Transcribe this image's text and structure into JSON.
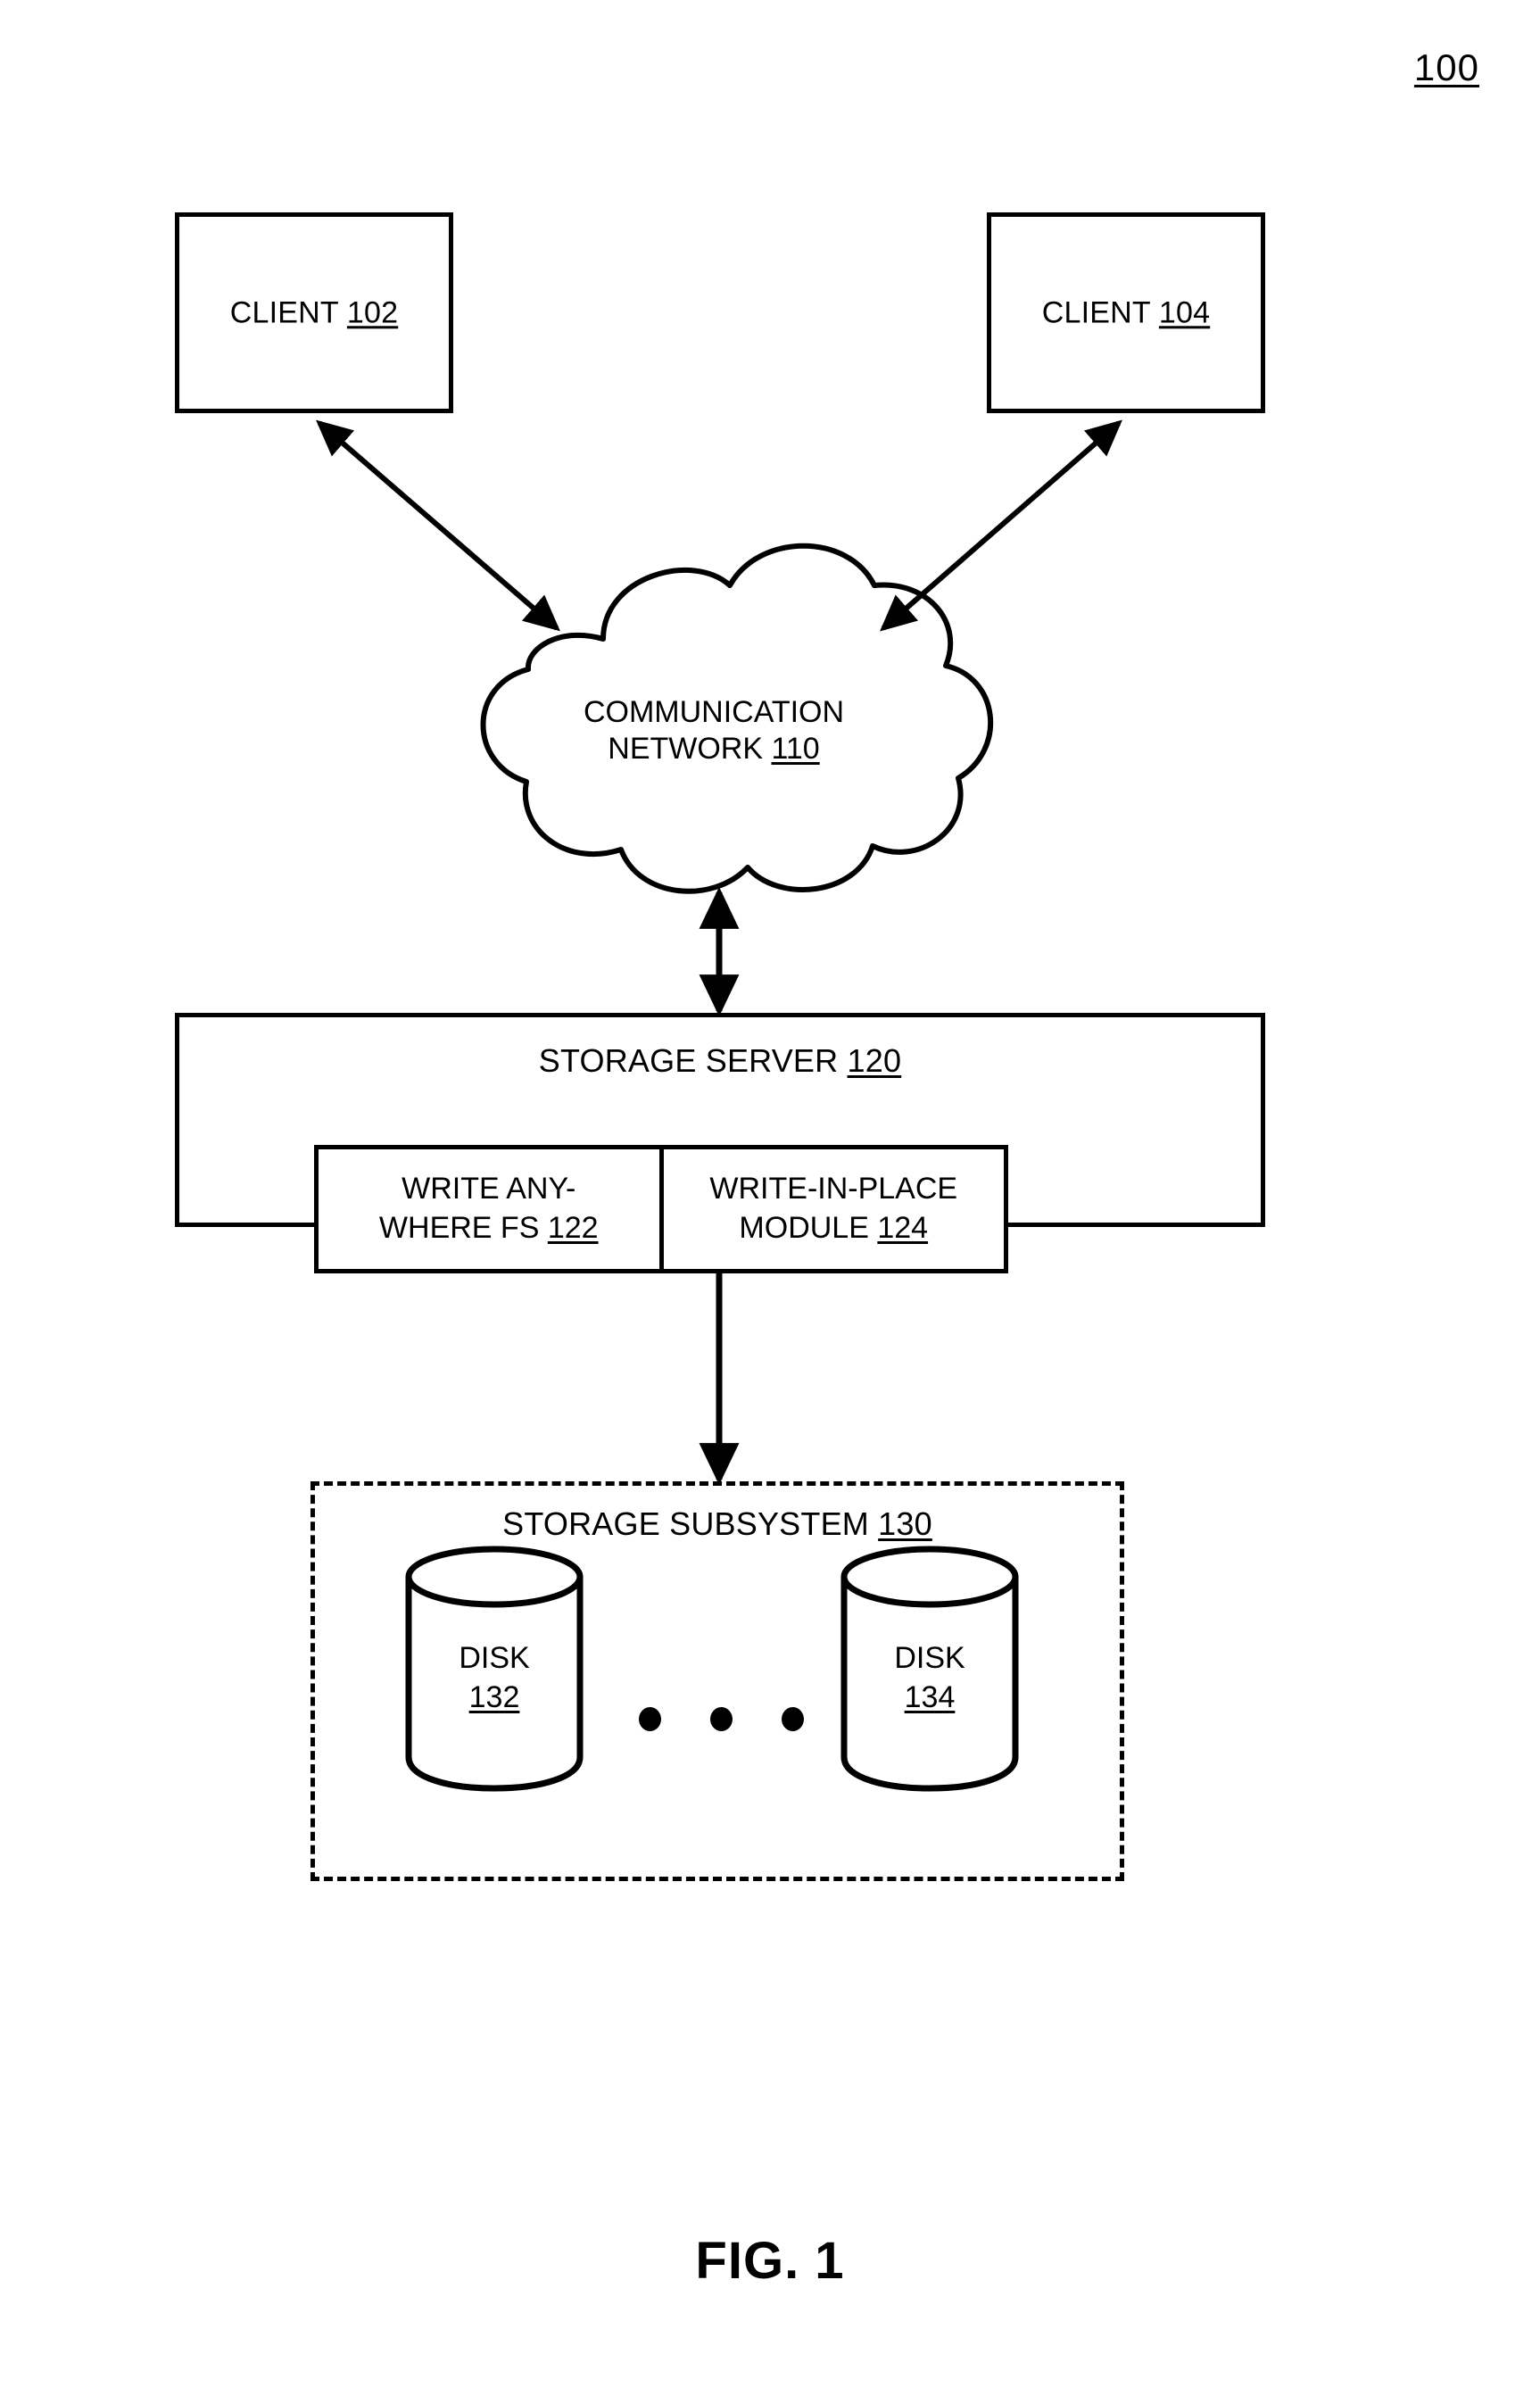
{
  "figure": {
    "reference_number": "100",
    "caption": "FIG. 1"
  },
  "clients": [
    {
      "name": "client-102",
      "label": "CLIENT",
      "ref": "102"
    },
    {
      "name": "client-104",
      "label": "CLIENT",
      "ref": "104"
    }
  ],
  "network": {
    "line1": "COMMUNICATION",
    "line2": "NETWORK",
    "ref": "110"
  },
  "storage_server": {
    "title": "STORAGE SERVER",
    "ref": "120",
    "modules": [
      {
        "line1": "WRITE ANY-",
        "line2": "WHERE FS",
        "ref": "122"
      },
      {
        "line1": "WRITE-IN-PLACE",
        "line2": "MODULE",
        "ref": "124"
      }
    ]
  },
  "storage_subsystem": {
    "title": "STORAGE SUBSYSTEM",
    "ref": "130",
    "disks": [
      {
        "label": "DISK",
        "ref": "132"
      },
      {
        "label": "DISK",
        "ref": "134"
      }
    ],
    "ellipsis": "• • •"
  },
  "colors": {
    "stroke": "#000000",
    "background": "#ffffff"
  }
}
